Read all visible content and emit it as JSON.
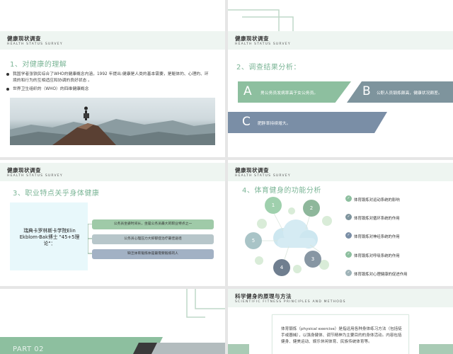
{
  "header": {
    "title": "健康现状调查",
    "subtitle": "HEALTH STATUS SURVEY"
  },
  "slide1": {
    "section_title": "1、对健康的理解",
    "bullets": [
      "我国学者张铁民综合了WHO的健康概念内涵，1992 年提出:健康是人类的基本需要，是躯体的、心理的、环境的和行为的互相适应和协调的良好状态 。",
      "世界卫生组织的（WHO）的四维健康概念"
    ]
  },
  "slide2": {
    "section_title": "2、调查结果分析：",
    "cards": [
      {
        "letter": "A",
        "text": "男公务员发病率高于女公务员。"
      },
      {
        "letter": "B",
        "text": "公职人员锻炼颇高，健康状况颇差。"
      },
      {
        "letter": "C",
        "text": "肥胖率持续增大。"
      }
    ]
  },
  "slide3": {
    "section_title": "3、职业特点关乎身体健康",
    "box_text": "瑞典卡罗林斯卡学院Elin Ekblom-Bak博士 \"45+5理论\"：",
    "pills": [
      "公务员坐姿时间长，坐是公务员最大的职业特点之一",
      "公务员心理压力大抑郁症治疗最佳途径",
      "缺乏体育锻炼体是最需要锻炼的人"
    ]
  },
  "slide4": {
    "section_title": "4、体育健身的功能分析",
    "circles": [
      "1",
      "2",
      "3",
      "4",
      "5"
    ],
    "items": [
      "体育锻炼对运动系统的影响",
      "体育锻炼对循环系统的作用",
      "体育锻炼对神经系统的作用",
      "体育锻炼对呼吸系统的作用",
      "体育锻炼对心理健康的促进作用"
    ]
  },
  "slide5": {
    "part_label": "PART 02"
  },
  "slide6": {
    "title": "科学健身的原理与方法",
    "subtitle": "SCIENTIFIC FITNESS PRINCIPLES AND METHODS",
    "text": "体育锻炼（physical exercise）是指运用各种身体练习方法（包括徒手或器械），以强身健体、调节精神为主要目的的身体活动。内容包括健身、健美运动、娱乐休闲体育、民族传统体育等。"
  },
  "colors": {
    "green": "#8dbf9f",
    "slate": "#7e949d",
    "blue": "#7a8ea6",
    "header_bg": "#eef5f1",
    "accent_text": "#7bb596"
  }
}
